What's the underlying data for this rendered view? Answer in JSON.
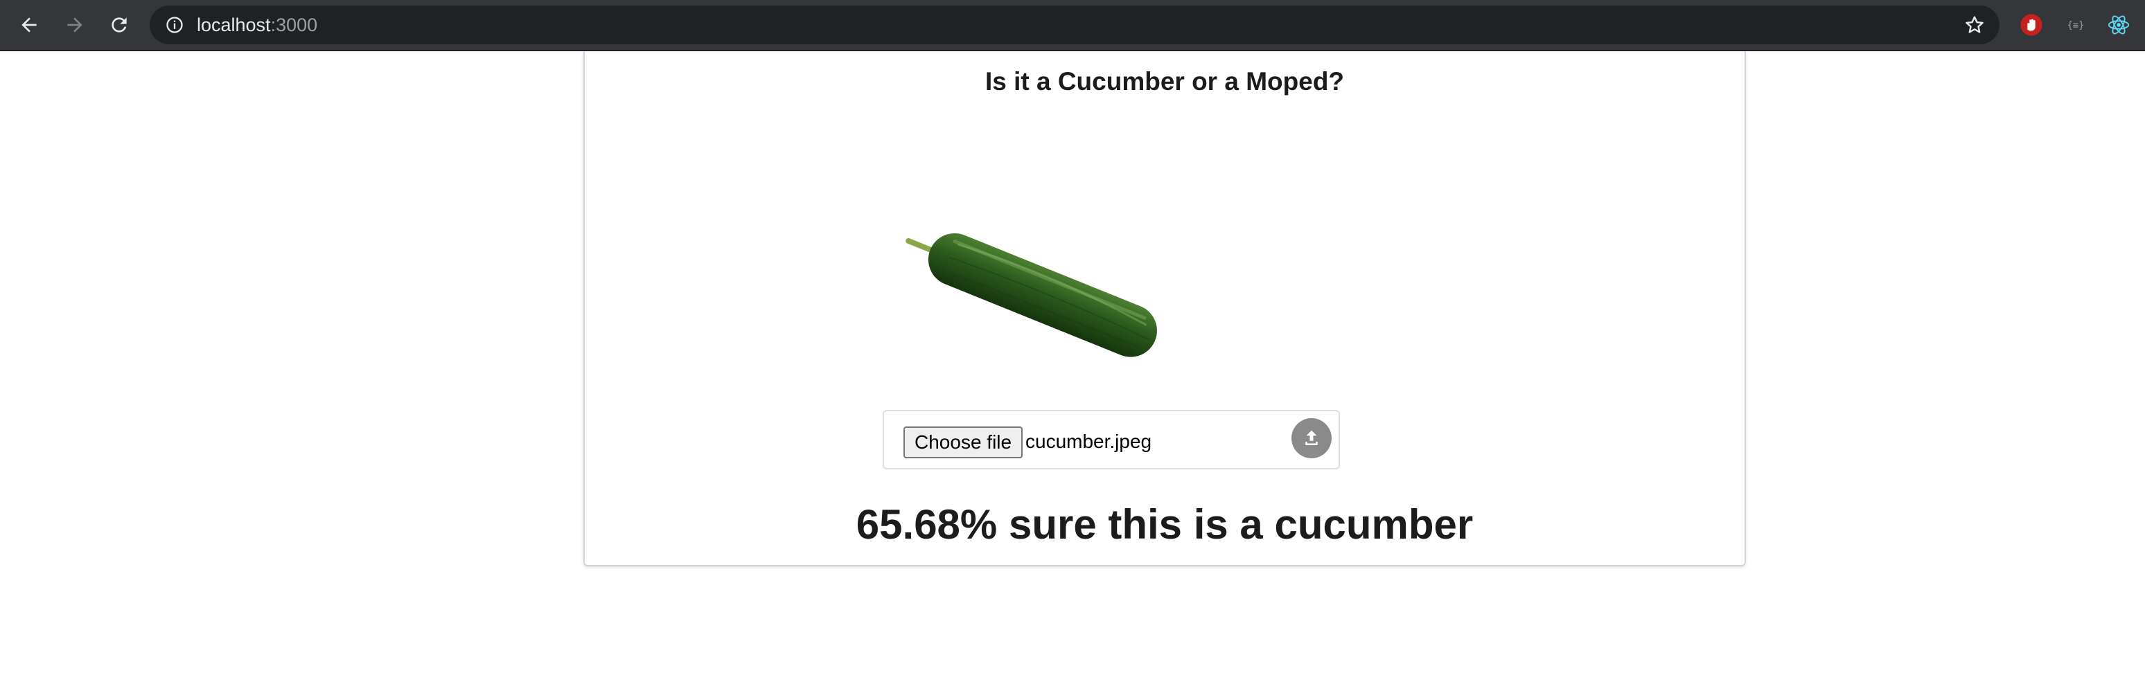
{
  "browser": {
    "url_host": "localhost",
    "url_port": ":3000",
    "back_icon": "arrow-left-icon",
    "forward_icon": "arrow-right-icon",
    "reload_icon": "reload-icon",
    "info_icon": "info-circle-icon",
    "bookmark_icon": "star-outline-icon",
    "extensions": [
      "ublock-hand-icon",
      "json-braces-icon",
      "react-atom-icon"
    ]
  },
  "page": {
    "title": "Is it a Cucumber or a Moped?",
    "preview_image": "cucumber-image",
    "upload": {
      "choose_label": "Choose file",
      "file_name": "cucumber.jpeg",
      "submit_icon": "upload-icon"
    },
    "result_text": "65.68% sure this is a cucumber"
  },
  "colors": {
    "chrome_bg": "#35363a",
    "omnibox_bg": "#202124",
    "text_dark": "#1b1c1d",
    "upload_button": "#8a8a8a",
    "cucumber_green": "#2f5f1f"
  }
}
